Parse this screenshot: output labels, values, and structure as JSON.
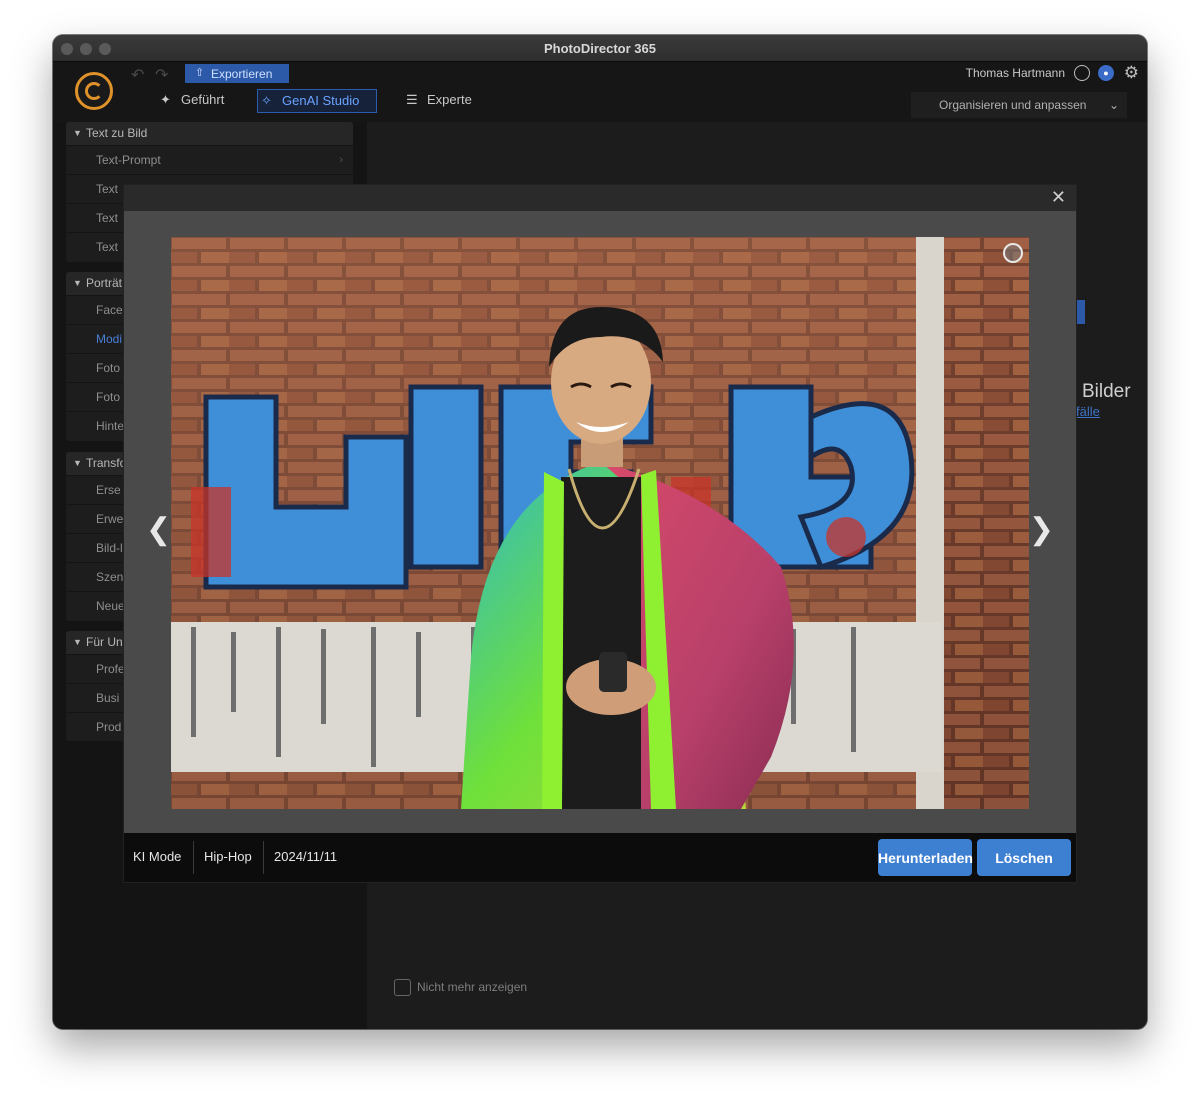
{
  "window": {
    "title": "PhotoDirector 365"
  },
  "toolbar": {
    "export_label": "Exportieren",
    "user_name": "Thomas Hartmann",
    "tabs": [
      {
        "label": "Geführt",
        "icon": "magic-wand-icon"
      },
      {
        "label": "GenAI Studio",
        "icon": "sparkle-icon",
        "active": true
      },
      {
        "label": "Experte",
        "icon": "layers-icon"
      }
    ],
    "workspace_select": "Organisieren und anpassen"
  },
  "sidebar": {
    "groups": [
      {
        "title": "Text zu Bild",
        "items": [
          "Text-Prompt",
          "Text",
          "Text",
          "Text"
        ]
      },
      {
        "title": "Porträt",
        "items": [
          "Face",
          "Modi",
          "Foto",
          "Foto",
          "Hinte"
        ]
      },
      {
        "title": "Transfo",
        "items": [
          "Erse",
          "Erwe",
          "Bild-l",
          "Szen",
          "Neue"
        ]
      },
      {
        "title": "Für Un",
        "items": [
          "Profe",
          "Busi",
          "Prod"
        ]
      }
    ],
    "selected_item": "Modi"
  },
  "background": {
    "bilder_text": "Bilder",
    "faelle_link": "fälle",
    "dont_show_label": "Nicht mehr anzeigen"
  },
  "modal": {
    "mode": "KI Mode",
    "style": "Hip-Hop",
    "date": "2024/11/11",
    "download_label": "Herunterladen",
    "delete_label": "Löschen"
  },
  "colors": {
    "accent": "#3d7fd0",
    "brand": "#e0922a",
    "selected": "#4a7fd6"
  }
}
